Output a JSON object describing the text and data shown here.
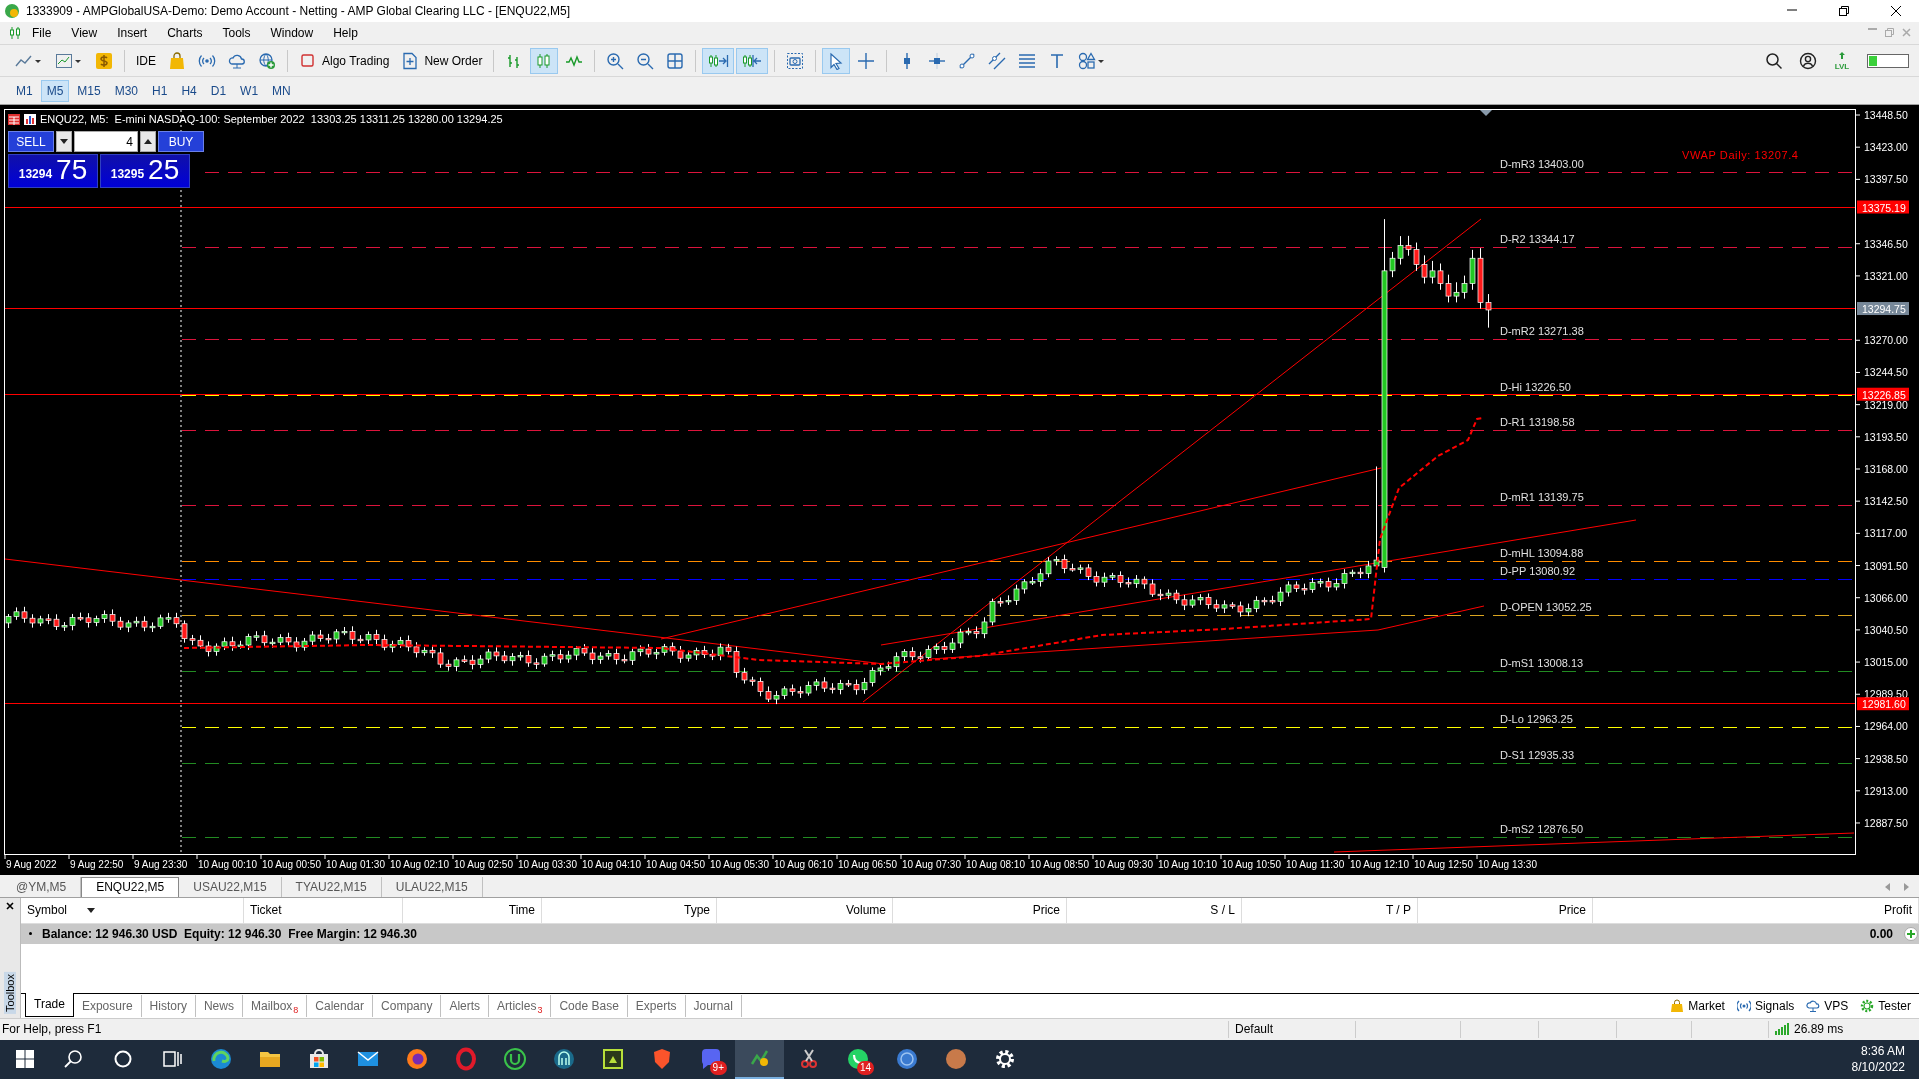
{
  "window": {
    "title": "1333909 - AMPGlobalUSA-Demo: Demo Account - Netting - AMP Global Clearing LLC - [ENQU22,M5]"
  },
  "menu": [
    {
      "label": "File"
    },
    {
      "label": "View"
    },
    {
      "label": "Insert"
    },
    {
      "label": "Charts"
    },
    {
      "label": "Tools"
    },
    {
      "label": "Window"
    },
    {
      "label": "Help"
    }
  ],
  "toolbar": [
    {
      "kind": "icon",
      "selected": false
    },
    {
      "kind": "icon",
      "selected": false
    },
    {
      "kind": "icon",
      "selected": false
    },
    {
      "kind": "separator"
    },
    {
      "kind": "text",
      "label": "IDE"
    },
    {
      "kind": "icon",
      "selected": false
    },
    {
      "kind": "icon",
      "selected": false
    },
    {
      "kind": "icon",
      "selected": false
    },
    {
      "kind": "icon",
      "selected": false
    },
    {
      "kind": "separator"
    },
    {
      "kind": "icon-text",
      "label": "Algo Trading"
    },
    {
      "kind": "icon-text",
      "label": "New Order"
    },
    {
      "kind": "separator"
    },
    {
      "kind": "icon",
      "selected": false
    },
    {
      "kind": "icon",
      "selected": true
    },
    {
      "kind": "icon",
      "selected": false
    },
    {
      "kind": "separator"
    },
    {
      "kind": "icon",
      "selected": false
    },
    {
      "kind": "icon",
      "selected": false
    },
    {
      "kind": "icon",
      "selected": false
    },
    {
      "kind": "separator"
    },
    {
      "kind": "icon",
      "selected": true
    },
    {
      "kind": "icon",
      "selected": true
    },
    {
      "kind": "separator"
    },
    {
      "kind": "icon",
      "selected": false
    },
    {
      "kind": "separator"
    },
    {
      "kind": "icon",
      "selected": true
    },
    {
      "kind": "icon",
      "selected": false
    },
    {
      "kind": "separator"
    },
    {
      "kind": "icon",
      "selected": false
    },
    {
      "kind": "icon",
      "selected": false
    },
    {
      "kind": "icon",
      "selected": false
    },
    {
      "kind": "icon",
      "selected": false
    },
    {
      "kind": "icon",
      "selected": false
    },
    {
      "kind": "icon",
      "selected": false
    },
    {
      "kind": "icon",
      "selected": false
    }
  ],
  "toolbar_right": {
    "lvl": "LVL"
  },
  "timeframes": [
    {
      "label": "M1",
      "selected": false
    },
    {
      "label": "M5",
      "selected": true
    },
    {
      "label": "M15",
      "selected": false
    },
    {
      "label": "M30",
      "selected": false
    },
    {
      "label": "H1",
      "selected": false
    },
    {
      "label": "H4",
      "selected": false
    },
    {
      "label": "D1",
      "selected": false
    },
    {
      "label": "W1",
      "selected": false
    },
    {
      "label": "MN",
      "selected": false
    }
  ],
  "chart": {
    "info": "ENQU22, M5:  E-mini NASDAQ-100: September 2022  13303.25 13311.25 13280.00 13294.25",
    "trade_panel": {
      "sell": "SELL",
      "volume": "4",
      "buy": "BUY",
      "bid": "13294",
      "bid_points": "75",
      "ask": "13295",
      "ask_points": "25"
    },
    "vwap": "VWAP Daily: 13207.4",
    "levels": [
      {
        "label": "D-mR3 13403.00",
        "color": "#dc143c"
      },
      {
        "label": "D-R2 13344.17",
        "color": "#dc143c"
      },
      {
        "label": "D-mR2 13271.38",
        "color": "#dc143c"
      },
      {
        "label": "D-Hi 13226.50",
        "color": "#ffff00"
      },
      {
        "label": "D-R1 13198.58",
        "color": "#dc143c"
      },
      {
        "label": "D-mR1 13139.75",
        "color": "#dc143c"
      },
      {
        "label": "D-mHL 13094.88",
        "color": "#ff8c00"
      },
      {
        "label": "D-PP 13080.92",
        "color": "#0000ff"
      },
      {
        "label": "D-OPEN 13052.25",
        "color": "#daa520"
      },
      {
        "label": "D-mS1 13008.13",
        "color": "#228b22"
      },
      {
        "label": "D-Lo 12963.25",
        "color": "#ffff00"
      },
      {
        "label": "D-S1 12935.33",
        "color": "#228b22"
      },
      {
        "label": "D-mS2 12876.50",
        "color": "#228b22"
      }
    ],
    "price_axis": [
      "13448.50",
      "13423.00",
      "13397.50",
      "13346.50",
      "13321.00",
      "13270.00",
      "13244.50",
      "13219.00",
      "13193.50",
      "13168.00",
      "13142.50",
      "13117.00",
      "13091.50",
      "13066.00",
      "13040.50",
      "13015.00",
      "12989.50",
      "12964.00",
      "12938.50",
      "12913.00",
      "12887.50"
    ],
    "price_tags": [
      {
        "label": "13375.19",
        "color": "#ff0000"
      },
      {
        "label": "13294.75",
        "color": "#778899"
      },
      {
        "label": "13226.85",
        "color": "#ff0000"
      },
      {
        "label": "12981.60",
        "color": "#ff0000"
      }
    ],
    "time_axis": [
      "9 Aug 2022",
      "9 Aug 22:50",
      "9 Aug 23:30",
      "10 Aug 00:10",
      "10 Aug 00:50",
      "10 Aug 01:30",
      "10 Aug 02:10",
      "10 Aug 02:50",
      "10 Aug 03:30",
      "10 Aug 04:10",
      "10 Aug 04:50",
      "10 Aug 05:30",
      "10 Aug 06:10",
      "10 Aug 06:50",
      "10 Aug 07:30",
      "10 Aug 08:10",
      "10 Aug 08:50",
      "10 Aug 09:30",
      "10 Aug 10:10",
      "10 Aug 10:50",
      "10 Aug 11:30",
      "10 Aug 12:10",
      "10 Aug 12:50",
      "10 Aug 13:30"
    ]
  },
  "chart_tabs": [
    {
      "label": "@YM,M5",
      "selected": false
    },
    {
      "label": "ENQU22,M5",
      "selected": true
    },
    {
      "label": "USAU22,M15",
      "selected": false
    },
    {
      "label": "TYAU22,M15",
      "selected": false
    },
    {
      "label": "ULAU22,M15",
      "selected": false
    }
  ],
  "toolbox": {
    "label": "Toolbox",
    "columns": [
      "Symbol",
      "Ticket",
      "Time",
      "Type",
      "Volume",
      "Price",
      "S / L",
      "T / P",
      "Price",
      "Profit"
    ],
    "balance": "Balance: 12 946.30 USD  Equity: 12 946.30  Free Margin: 12 946.30",
    "profit": "0.00",
    "tabs": [
      {
        "label": "Trade",
        "selected": true
      },
      {
        "label": "Exposure",
        "selected": false
      },
      {
        "label": "History",
        "selected": false
      },
      {
        "label": "News",
        "selected": false
      },
      {
        "label": "Mailbox",
        "badge": "8",
        "selected": false
      },
      {
        "label": "Calendar",
        "selected": false
      },
      {
        "label": "Company",
        "selected": false
      },
      {
        "label": "Alerts",
        "selected": false
      },
      {
        "label": "Articles",
        "badge": "3",
        "selected": false
      },
      {
        "label": "Code Base",
        "selected": false
      },
      {
        "label": "Experts",
        "selected": false
      },
      {
        "label": "Journal",
        "selected": false
      }
    ],
    "links": [
      {
        "label": "Market"
      },
      {
        "label": "Signals"
      },
      {
        "label": "VPS"
      },
      {
        "label": "Tester"
      }
    ]
  },
  "status_bar": {
    "help": "For Help, press F1",
    "profile": "Default",
    "ping": "26.89 ms"
  },
  "taskbar": {
    "apps": [
      {
        "selected": false
      },
      {
        "selected": false
      },
      {
        "selected": false
      },
      {
        "selected": false
      },
      {
        "selected": false
      },
      {
        "selected": false
      },
      {
        "selected": false
      },
      {
        "selected": false
      },
      {
        "selected": false
      },
      {
        "selected": false
      },
      {
        "selected": false,
        "badge": "9+"
      },
      {
        "selected": true
      },
      {
        "selected": false
      },
      {
        "selected": false,
        "badge": "14"
      },
      {
        "selected": false
      },
      {
        "selected": false
      },
      {
        "selected": false
      }
    ],
    "time": "8:36 AM",
    "date": "8/10/2022"
  }
}
